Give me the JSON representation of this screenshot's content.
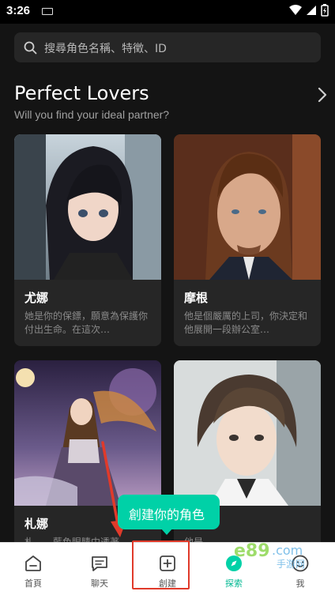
{
  "status_bar": {
    "time": "3:26"
  },
  "search": {
    "placeholder": "搜尋角色名稱、特徵、ID"
  },
  "section": {
    "title": "Perfect Lovers",
    "subtitle": "Will you find your ideal partner?"
  },
  "cards": [
    {
      "name": "尤娜",
      "desc": "她是你的保鏢，願意為保護你付出生命。在這次…"
    },
    {
      "name": "摩根",
      "desc": "他是個嚴厲的上司，你決定和他展開一段辦公室…"
    },
    {
      "name": "札娜",
      "desc": "札…　藍色眼睛中透著…"
    },
    {
      "name": "",
      "desc": "他是…"
    }
  ],
  "tooltip": {
    "text": "創建你的角色"
  },
  "tabs": [
    {
      "label": "首頁",
      "icon": "home-icon"
    },
    {
      "label": "聊天",
      "icon": "chat-icon"
    },
    {
      "label": "創建",
      "icon": "create-plus-icon"
    },
    {
      "label": "探索",
      "icon": "explore-icon"
    },
    {
      "label": "我",
      "icon": "profile-icon"
    }
  ],
  "watermark": {
    "text": "e89 .com",
    "sub": "手游网"
  },
  "colors": {
    "accent": "#00d1a7",
    "highlight": "#e03a2a",
    "background": "#141414",
    "card": "#262626"
  }
}
